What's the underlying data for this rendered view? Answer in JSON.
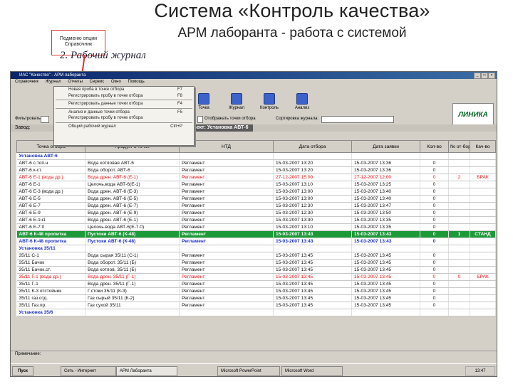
{
  "slide": {
    "title": "Система «Контроль качества»",
    "subtitle": "АРМ лаборанта - работа с системой",
    "callout_text": "Подменю опции Справочник",
    "caption": "2. Рабочий журнал"
  },
  "window": {
    "title": "ИАС \"Качество\" - АРМ лаборанта",
    "menu": [
      "Справочник",
      "Журнал",
      "Отчеты",
      "Сервис",
      "Окно",
      "Помощь"
    ]
  },
  "dropdown": {
    "items": [
      {
        "label": "Новая проба в точке отбора",
        "shortcut": "F7"
      },
      {
        "label": "Регистрировать пробу в точке отбора",
        "shortcut": "F8"
      },
      {
        "label": "Регистрировать данные точки отбора",
        "shortcut": "F4"
      },
      {
        "label": "Анализ и данные точки отбора",
        "shortcut": "F5"
      },
      {
        "label": "Регистрировать пробу в точке отбора",
        "shortcut": ""
      },
      {
        "label": "Общий рабочий журнал",
        "shortcut": "Ctrl+P"
      }
    ]
  },
  "toolbar": {
    "buttons": [
      "Точка",
      "Журнал",
      "Контроль",
      "Анализ"
    ],
    "logo": "ЛИНИКА"
  },
  "filter": {
    "label": "Фильтровать",
    "checkbox_label": "Отображать точки отбора",
    "sort_label": "Сортировка журнала:"
  },
  "object_bar": {
    "zavod_label": "Завод:",
    "object": "Объект: Установка АВТ-6"
  },
  "table": {
    "headers": [
      "Точка отбора",
      "Продукт в точке",
      "НТД",
      "Дата отбора",
      "Дата заявки",
      "Кол-во",
      "№ от-бора",
      "Кач-во"
    ],
    "rows": [
      {
        "kind": "group",
        "cells": [
          "Установка АВТ-6",
          "",
          "",
          "",
          "",
          "",
          "",
          ""
        ]
      },
      {
        "kind": "normal",
        "cells": [
          "АВТ-6 с.топ.н",
          "Вода котловая АВТ-6",
          "Регламент",
          "15-03-2007 13:20",
          "15-03-2007 13:36",
          "0",
          "",
          ""
        ]
      },
      {
        "kind": "normal",
        "cells": [
          "АВТ-6 к-ст.",
          "Вода оборот. АВТ-6",
          "Регламент",
          "15-03-2007 13:20",
          "15-03-2007 13:36",
          "0",
          "",
          ""
        ]
      },
      {
        "kind": "red",
        "cells": [
          "АВТ-6 Е-1 (вода др.)",
          "Вода дрен. АВТ-6 (Е-1)",
          "Регламент",
          "27-12-2007 15:00",
          "27-12-2007 12:00",
          "0",
          "2",
          "БРАК"
        ]
      },
      {
        "kind": "normal",
        "cells": [
          "АВТ-6 Е-1",
          "Целочь.вода АВТ-6(Е-1)",
          "Регламент",
          "15-03-2007 13:10",
          "15-03-2007 13:25",
          "0",
          "",
          ""
        ]
      },
      {
        "kind": "normal",
        "cells": [
          "АВТ-6 Е-3 (вода др.)",
          "Вода дрен. АВТ-6 (Е-3)",
          "Регламент",
          "15-03-2007 13:00",
          "15-03-2007 13:40",
          "0",
          "",
          ""
        ]
      },
      {
        "kind": "normal",
        "cells": [
          "АВТ-6 Е-5",
          "Вода дрен. АВТ-6 (Е-5)",
          "Регламент",
          "15-03-2007 13:00",
          "15-03-2007 13:40",
          "0",
          "",
          ""
        ]
      },
      {
        "kind": "normal",
        "cells": [
          "АВТ-6 Е-7",
          "Вода дрен. АВТ-6 (Е-7)",
          "Регламент",
          "15-03-2007 12:30",
          "15-03-2007 13:47",
          "0",
          "",
          ""
        ]
      },
      {
        "kind": "normal",
        "cells": [
          "АВТ-6 Е-9",
          "Вода дрен. АВТ-6 (Е-9)",
          "Регламент",
          "15-03-2007 12:30",
          "15-03-2007 13:50",
          "0",
          "",
          ""
        ]
      },
      {
        "kind": "normal",
        "cells": [
          "АВТ-6 Е-1ч1",
          "Вода дрен. АВТ-6 (Е-1)",
          "Регламент",
          "15-03-2007 13:30",
          "15-03-2007 13:35",
          "0",
          "",
          ""
        ]
      },
      {
        "kind": "normal",
        "cells": [
          "АВТ-6 Е-7.0",
          "Целочь.вода АВТ-6(Е-7.0)",
          "Регламент",
          "15-03-2007 13:10",
          "15-03-2007 13:35",
          "0",
          "",
          ""
        ]
      },
      {
        "kind": "green",
        "cells": [
          "АВТ-6 К-48 пропитка",
          "Пустоки АВТ-6 (К-48)",
          "Регламент",
          "15-03-2007 13:43",
          "15-03-2007 13:43",
          "0",
          "1",
          "СТАНД"
        ]
      },
      {
        "kind": "group",
        "cells": [
          "АВТ-6 К-48 пропитка",
          "Пустоки АВТ-6 (К-48)",
          "Регламент",
          "15-03-2007 13:43",
          "15-03-2007 13:43",
          "0",
          "",
          ""
        ]
      },
      {
        "kind": "group",
        "cells": [
          "Установка 35/11",
          "",
          "",
          "",
          "",
          "",
          "",
          ""
        ]
      },
      {
        "kind": "normal",
        "cells": [
          "35/11 С-1",
          "Вода сырая 35/11 (С-1)",
          "Регламент",
          "15-03-2007 13:45",
          "15-03-2007 13:45",
          "0",
          "",
          ""
        ]
      },
      {
        "kind": "normal",
        "cells": [
          "35/11 Бачок",
          "Вода оборот. 35/11 (Б)",
          "Регламент",
          "15-03-2007 13:45",
          "15-03-2007 13:45",
          "0",
          "",
          ""
        ]
      },
      {
        "kind": "normal",
        "cells": [
          "35/11 Бачок.ст.",
          "Вода котлов. 35/11 (Б)",
          "Регламент",
          "15-03-2007 13:45",
          "15-03-2007 13:45",
          "0",
          "",
          ""
        ]
      },
      {
        "kind": "red",
        "cells": [
          "35/11 Г-1 (вода др.)",
          "Вода дрен. 35/11 (Г-1)",
          "Регламент",
          "15-03-2007 13:45",
          "15-03-2007 13:45",
          "0",
          "0",
          "БРАК"
        ]
      },
      {
        "kind": "normal",
        "cells": [
          "35/11 Г-1",
          "Вода дрен. 35/11 (Г-1)",
          "Регламент",
          "15-03-2007 13:45",
          "15-03-2007 13:45",
          "0",
          "",
          ""
        ]
      },
      {
        "kind": "normal",
        "cells": [
          "35/11 К-3 отстойник",
          "Г.стоки 35/11 (К-3)",
          "Регламент",
          "15-03-2007 13:45",
          "15-03-2007 13:45",
          "0",
          "",
          ""
        ]
      },
      {
        "kind": "normal",
        "cells": [
          "35/11 газ.отд.",
          "Газ сырый 35/11 (К-2)",
          "Регламент",
          "15-03-2007 13:45",
          "15-03-2007 13:45",
          "0",
          "",
          ""
        ]
      },
      {
        "kind": "normal",
        "cells": [
          "35/11 Газ.пр.",
          "Газ сухой 35/11",
          "Регламент",
          "15-03-2007 13:45",
          "15-03-2007 13:45",
          "0",
          "",
          ""
        ]
      },
      {
        "kind": "group",
        "cells": [
          "Установка 35/6",
          "",
          "",
          "",
          "",
          "",
          "",
          ""
        ]
      }
    ]
  },
  "notes": {
    "label": "Примечание:"
  },
  "taskbar": {
    "start": "Пуск",
    "items": [
      "Сеть - Интернет",
      "АРМ Лаборанта",
      "Microsoft PowerPoint",
      "Microsoft Word"
    ],
    "clock": "13:47"
  }
}
